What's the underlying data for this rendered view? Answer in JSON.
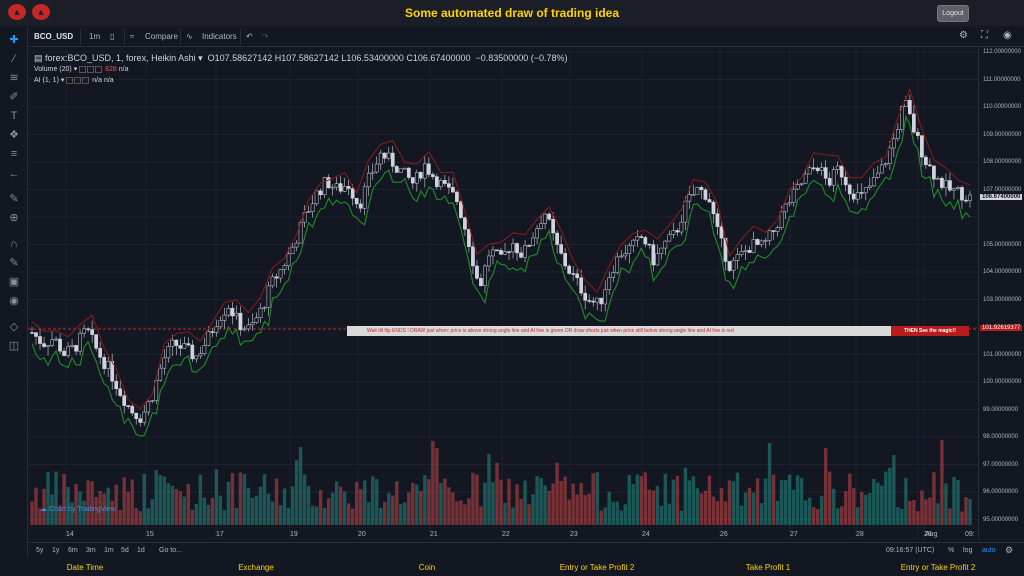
{
  "app": {
    "title": "Some automated draw of trading idea",
    "logout_label": "Logout",
    "logo_icon": "bull-logo-icon"
  },
  "toolbar": {
    "symbol": "BCO_USD",
    "interval": "1m",
    "compare_label": "Compare",
    "indicators_label": "Indicators"
  },
  "legend": {
    "main": "forex:BCO_USD, 1, forex, Heikin Ashi",
    "open": "O107.58627142",
    "high": "H107.58627142",
    "low": "L106.53400000",
    "close": "C106.67400000",
    "change": "−0.83500000 (−0.78%)",
    "volume_name": "Volume (20)",
    "volume_value": "828",
    "volume_ma": "n/a",
    "ai_name": "AI (1, 1)",
    "ai_v1": "n/a",
    "ai_v2": "n/a"
  },
  "banner": {
    "text": "Wait till flip ENDS  !    DRAW just when:  price is above strong angle line and AI line is green        OR        draw shorts just when price still below strong angle line and AI line is red",
    "end_text": "THEN See the magic!!"
  },
  "price_axis": {
    "labels": [
      "112.00000000",
      "111.00000000",
      "110.00000000",
      "109.00000000",
      "108.00000000",
      "107.00000000",
      "105.00000000",
      "104.00000000",
      "103.00000000",
      "101.00000000",
      "100.00000000",
      "99.00000000",
      "98.00000000",
      "97.00000000",
      "96.00000000",
      "95.00000000"
    ],
    "current_price": "106.67400000",
    "line_price": "101.92619377"
  },
  "time_axis": {
    "labels": [
      "14",
      "15",
      "17",
      "19",
      "20",
      "21",
      "22",
      "23",
      "24",
      "26",
      "27",
      "28",
      "29",
      "Aug",
      "09:"
    ]
  },
  "bottombar": {
    "ranges": [
      "5y",
      "1y",
      "6m",
      "3m",
      "1m",
      "5d",
      "1d"
    ],
    "goto_label": "Go to...",
    "clock": "09:16:57 (UTC)",
    "percent_label": "%",
    "log_label": "log",
    "auto_label": "auto"
  },
  "watermark": "Chart by TradingView",
  "footer": {
    "columns": [
      "Date Time",
      "Exchange",
      "Coin",
      "Entry or Take Profit 2",
      "Take Profit 1",
      "Entry or Take Profit 2"
    ]
  },
  "chart_data": {
    "type": "candlestick",
    "ylim": [
      94.8,
      112.0
    ],
    "x_ticks": [
      "14",
      "15",
      "17",
      "19",
      "20",
      "21",
      "22",
      "23",
      "24",
      "26",
      "27",
      "28",
      "29",
      "Aug"
    ],
    "close_path": [
      101.8,
      101.4,
      101.6,
      101.0,
      101.3,
      101.9,
      101.1,
      100.5,
      99.7,
      99.0,
      98.7,
      99.5,
      100.8,
      101.4,
      101.2,
      100.9,
      101.5,
      102.3,
      102.8,
      102.1,
      101.9,
      102.6,
      103.6,
      104.2,
      105.0,
      106.0,
      106.8,
      107.3,
      107.0,
      107.2,
      106.4,
      107.5,
      108.3,
      108.0,
      107.6,
      107.2,
      107.9,
      107.4,
      107.0,
      106.6,
      105.2,
      103.4,
      104.8,
      104.4,
      105.1,
      104.6,
      105.4,
      106.2,
      105.0,
      104.2,
      103.6,
      103.0,
      102.8,
      104.0,
      104.7,
      104.9,
      105.3,
      104.4,
      105.0,
      105.4,
      106.5,
      107.0,
      106.8,
      105.2,
      104.2,
      104.6,
      105.0,
      104.9,
      105.5,
      106.3,
      106.9,
      107.5,
      107.9,
      107.2,
      107.8,
      107.0,
      106.7,
      107.2,
      107.8,
      108.8,
      110.2,
      109.0,
      108.0,
      107.4,
      107.0,
      106.9,
      106.7
    ],
    "red_line_price": 101.92619377
  }
}
